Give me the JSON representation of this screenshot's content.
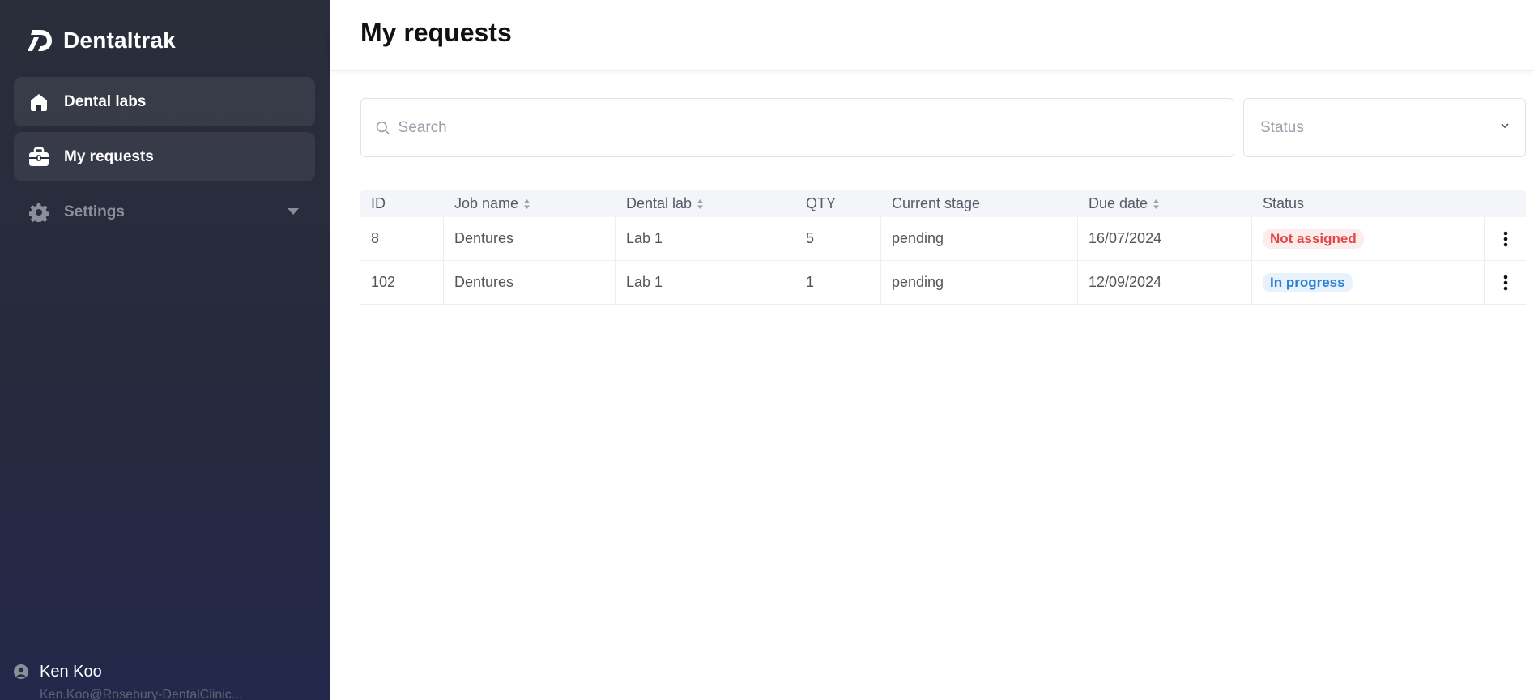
{
  "app": {
    "name": "Dentaltrak"
  },
  "sidebar": {
    "items": [
      {
        "label": "Dental labs",
        "icon": "house-icon"
      },
      {
        "label": "My requests",
        "icon": "briefcase-icon"
      },
      {
        "label": "Settings",
        "icon": "gear-icon"
      }
    ],
    "user": {
      "name": "Ken Koo",
      "email": "Ken.Koo@Rosebury-DentalClinic..."
    }
  },
  "header": {
    "title": "My requests"
  },
  "filters": {
    "search_placeholder": "Search",
    "status_placeholder": "Status"
  },
  "table": {
    "columns": [
      "ID",
      "Job name",
      "Dental lab",
      "QTY",
      "Current stage",
      "Due date",
      "Status"
    ],
    "rows": [
      {
        "id": "8",
        "job_name": "Dentures",
        "dental_lab": "Lab 1",
        "qty": "5",
        "stage": "pending",
        "due_date": "16/07/2024",
        "status": "Not assigned"
      },
      {
        "id": "102",
        "job_name": "Dentures",
        "dental_lab": "Lab 1",
        "qty": "1",
        "stage": "pending",
        "due_date": "12/09/2024",
        "status": "In progress"
      }
    ]
  },
  "colors": {
    "sidebar_bg": "#262a3c",
    "status_not_assigned": "#e04848",
    "status_in_progress": "#2a7fd4"
  }
}
